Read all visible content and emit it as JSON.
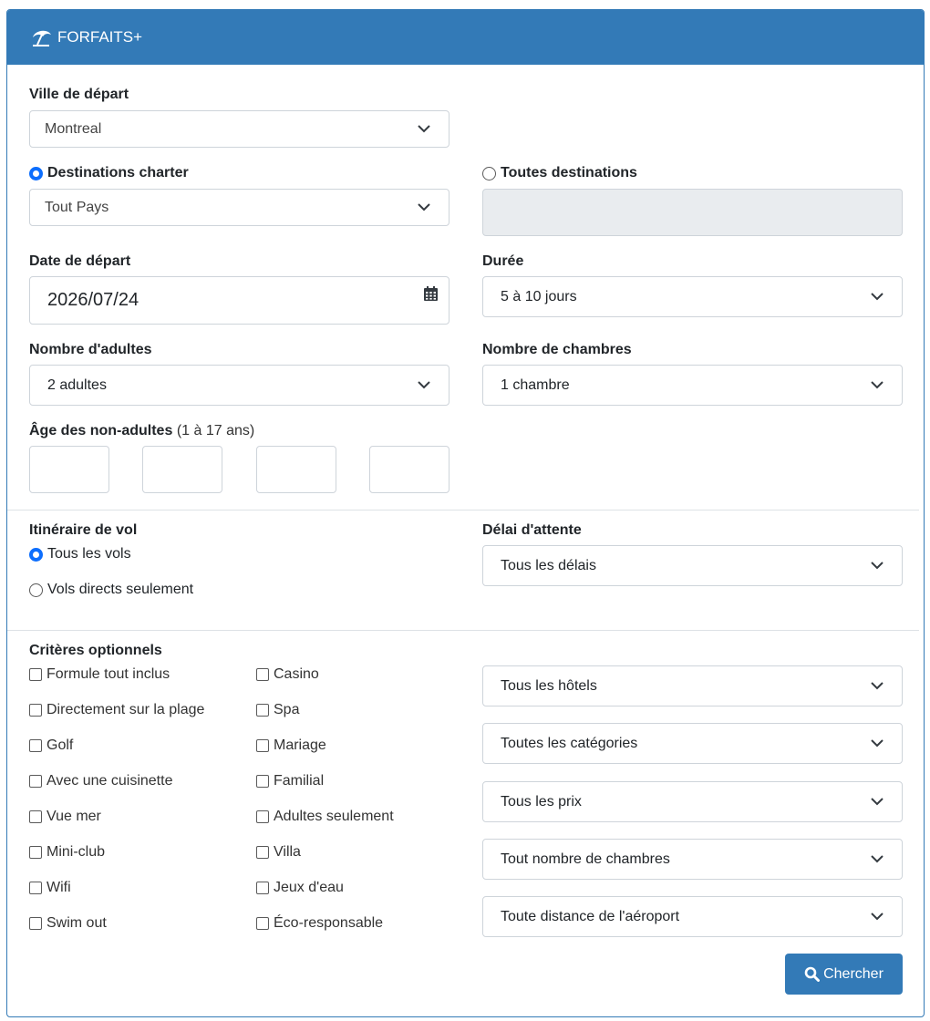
{
  "header": {
    "title": "FORFAITS+",
    "icon": "beach-umbrella-icon"
  },
  "departure_city": {
    "label": "Ville de départ",
    "value": "Montreal"
  },
  "destination_mode": {
    "charter_label": "Destinations charter",
    "all_label": "Toutes destinations",
    "selected": "charter"
  },
  "charter_destination": {
    "value": "Tout Pays"
  },
  "departure_date": {
    "label": "Date de départ",
    "value": "2026/07/24"
  },
  "duration": {
    "label": "Durée",
    "value": "5 à 10 jours"
  },
  "adults": {
    "label": "Nombre d'adultes",
    "value": "2 adultes"
  },
  "rooms": {
    "label": "Nombre de chambres",
    "value": "1 chambre"
  },
  "child_ages": {
    "label": "Âge des non-adultes",
    "hint": "(1 à 17 ans)"
  },
  "itinerary": {
    "label": "Itinéraire de vol",
    "option_all": "Tous les vols",
    "option_direct": "Vols directs seulement",
    "selected": "all"
  },
  "delay": {
    "label": "Délai d'attente",
    "value": "Tous les délais"
  },
  "criteria": {
    "label": "Critères optionnels",
    "col1": [
      "Formule tout inclus",
      "Directement sur la plage",
      "Golf",
      "Avec une cuisinette",
      "Vue mer",
      "Mini-club",
      "Wifi",
      "Swim out"
    ],
    "col2": [
      "Casino",
      "Spa",
      "Mariage",
      "Familial",
      "Adultes seulement",
      "Villa",
      "Jeux d'eau",
      "Éco-responsable"
    ]
  },
  "filters": {
    "hotels": "Tous les hôtels",
    "categories": "Toutes les catégories",
    "prices": "Tous les prix",
    "room_count": "Tout nombre de chambres",
    "airport_distance": "Toute distance de l'aéroport"
  },
  "search_button": {
    "label": "Chercher"
  },
  "colors": {
    "primary": "#337ab7",
    "radio_checked": "#0d6efd"
  }
}
